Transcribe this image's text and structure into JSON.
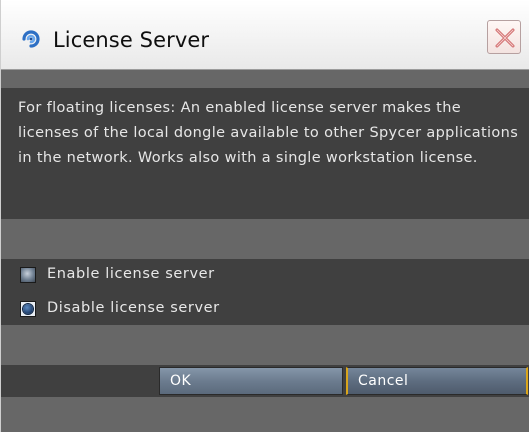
{
  "window": {
    "title": "License Server",
    "icon": "spycer-app-icon",
    "close_icon": "close-icon"
  },
  "description": "For floating licenses: An enabled license server makes the licenses of the local dongle available to other Spycer applications in the network. Works also with a single workstation license.",
  "options": {
    "enable_label": "Enable license server",
    "disable_label": "Disable license server",
    "selected": "disable"
  },
  "buttons": {
    "ok_label": "OK",
    "cancel_label": "Cancel"
  },
  "colors": {
    "accent_focus": "#d9a51c",
    "close_x": "#d06a6a"
  }
}
